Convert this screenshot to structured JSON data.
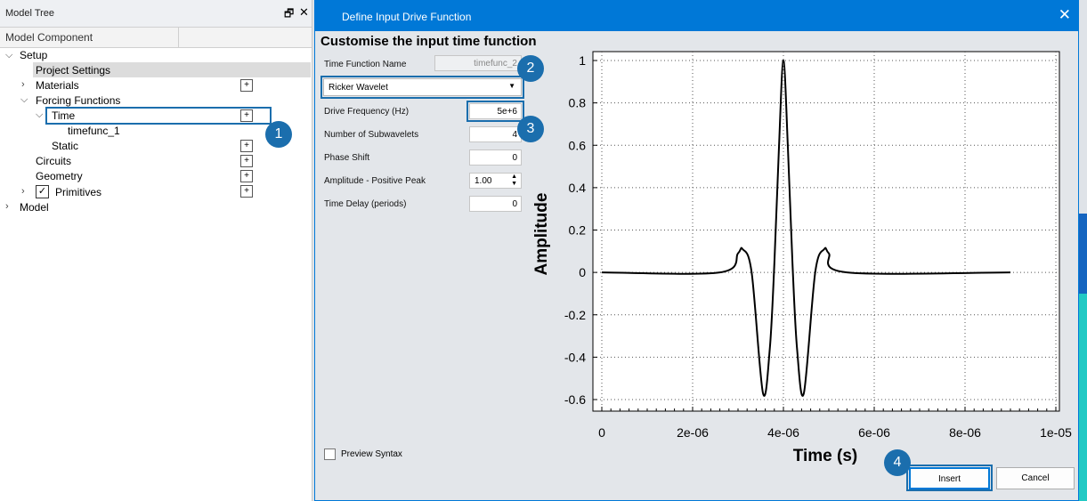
{
  "tree": {
    "title": "Model Tree",
    "pin_icon": "pin-icon",
    "close_icon": "close-icon",
    "column_header": "Model Component",
    "items": [
      {
        "label": "Setup"
      },
      {
        "label": "Project Settings"
      },
      {
        "label": "Materials"
      },
      {
        "label": "Forcing Functions"
      },
      {
        "label": "Time"
      },
      {
        "label": "timefunc_1"
      },
      {
        "label": "Static"
      },
      {
        "label": "Circuits"
      },
      {
        "label": "Geometry"
      },
      {
        "label": "Primitives"
      },
      {
        "label": "Model"
      }
    ],
    "plus_label": "+"
  },
  "dialog": {
    "title": "Define Input Drive Function",
    "close_glyph": "✕",
    "heading": "Customise the input time function",
    "fields": {
      "name_label": "Time Function Name",
      "name_value": "timefunc_2",
      "function_type": "Ricker Wavelet",
      "freq_label": "Drive Frequency (Hz)",
      "freq_value": "5e+6",
      "subwavelets_label": "Number of Subwavelets",
      "subwavelets_value": "4",
      "phase_label": "Phase Shift",
      "phase_value": "0",
      "amplitude_label": "Amplitude - Positive Peak",
      "amplitude_value": "1.00",
      "delay_label": "Time Delay (periods)",
      "delay_value": "0"
    },
    "preview_label": "Preview Syntax",
    "insert_label": "Insert",
    "cancel_label": "Cancel"
  },
  "callouts": [
    "1",
    "2",
    "3",
    "4"
  ],
  "colors": {
    "accent": "#0078d7",
    "callout": "#1b6ead",
    "cyan": "#23c9c4"
  },
  "chart_data": {
    "type": "line",
    "title": "",
    "xlabel": "Time (s)",
    "ylabel": "Amplitude",
    "xlim": [
      0,
      1e-05
    ],
    "ylim": [
      -0.6,
      1
    ],
    "x_ticks": [
      "0",
      "2e-06",
      "4e-06",
      "6e-06",
      "8e-06",
      "1e-05"
    ],
    "y_ticks": [
      "1",
      "0.8",
      "0.6",
      "0.4",
      "0.2",
      "0",
      "-0.2",
      "-0.4",
      "-0.6"
    ],
    "grid": true,
    "series": [
      {
        "x": [
          0,
          2.6e-06,
          3e-06,
          3.1e-06,
          3.3e-06,
          3.55e-06,
          3.7e-06,
          3.8e-06,
          3.9e-06,
          4e-06,
          4.1e-06,
          4.2e-06,
          4.3e-06,
          4.45e-06,
          4.7e-06,
          4.9e-06,
          5e-06,
          5.4e-06,
          9e-06
        ],
        "y": [
          0,
          0,
          0.09,
          0.11,
          0.0,
          -0.57,
          -0.36,
          0.04,
          0.58,
          1.0,
          0.58,
          0.04,
          -0.36,
          -0.57,
          0.0,
          0.11,
          0.09,
          0,
          0
        ]
      }
    ]
  }
}
